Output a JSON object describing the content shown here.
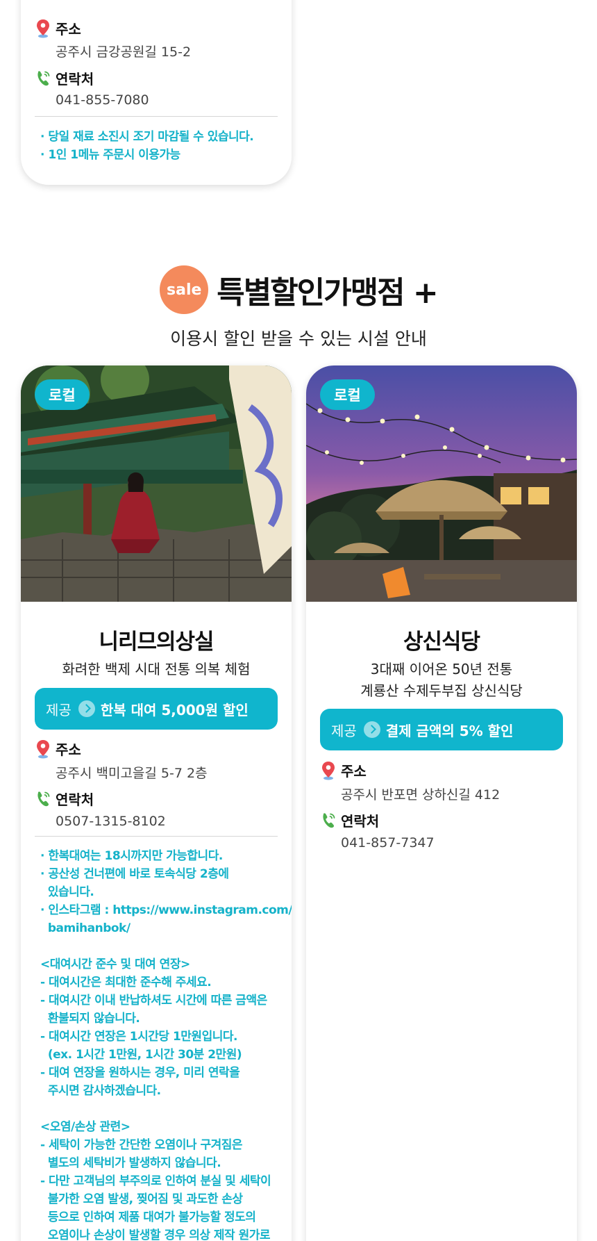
{
  "prev_card": {
    "address_label": "주소",
    "address": "공주시 금강공원길 15-2",
    "contact_label": "연락처",
    "phone": "041-855-7080",
    "notes": [
      "· 당일 재료 소진시 조기 마감될 수 있습니다.",
      "· 1인 1메뉴 주문시 이용가능"
    ]
  },
  "section": {
    "sale_badge": "sale",
    "title": "특별할인가맹점 +",
    "subtitle": "이용시 할인 받을 수 있는 시설 안내"
  },
  "cards": [
    {
      "badge": "로컬",
      "name": "니리므의상실",
      "desc_lines": [
        "화려한 백제 시대 전통 의복 체험"
      ],
      "offer_label": "제공",
      "offer_value": "한복 대여 5,000원 할인",
      "address_label": "주소",
      "address": "공주시 백미고을길 5-7 2층",
      "contact_label": "연락처",
      "phone": "0507-1315-8102",
      "notes": [
        "· 한복대여는 18시까지만 가능합니다.",
        "· 공산성 건너편에 바로 토속식당 2층에",
        "  있습니다.",
        "· 인스타그램 : https://www.instagram.com/",
        "  bamihanbok/",
        " ",
        "<대여시간 준수 및 대여 연장>",
        "- 대여시간은 최대한 준수해 주세요.",
        "- 대여시간 이내 반납하셔도 시간에 따른 금액은",
        "  환불되지 않습니다.",
        "- 대여시간 연장은 1시간당 1만원입니다.",
        "  (ex. 1시간 1만원, 1시간 30분 2만원)",
        "- 대여 연장을 원하시는 경우, 미리 연락을",
        "  주시면 감사하겠습니다.",
        " ",
        "<오염/손상 관련>",
        "- 세탁이 가능한 간단한 오염이나 구겨짐은",
        "  별도의 세탁비가 발생하지 않습니다.",
        "- 다만 고객님의 부주의로 인하여 분실 및 세탁이",
        "  불가한 오염 발생, 찢어짐 및 과도한 손상",
        "  등으로 인하여 제품 대여가 불가능할 정도의",
        "  오염이나 손상이 발생할 경우 의상 제작 원가로"
      ]
    },
    {
      "badge": "로컬",
      "name": "상신식당",
      "desc_lines": [
        "3대째 이어온 50년 전통",
        "계룡산 수제두부집 상신식당"
      ],
      "offer_label": "제공",
      "offer_value": "결제 금액의 5% 할인",
      "address_label": "주소",
      "address": "공주시 반포면 상하신길 412",
      "contact_label": "연락처",
      "phone": "041-857-7347"
    }
  ],
  "colors": {
    "accent": "#10b5cd",
    "note": "#14b2c9",
    "sale": "#f48a5c",
    "pin": "#e9484f",
    "phone_icon": "#4cae4c"
  }
}
